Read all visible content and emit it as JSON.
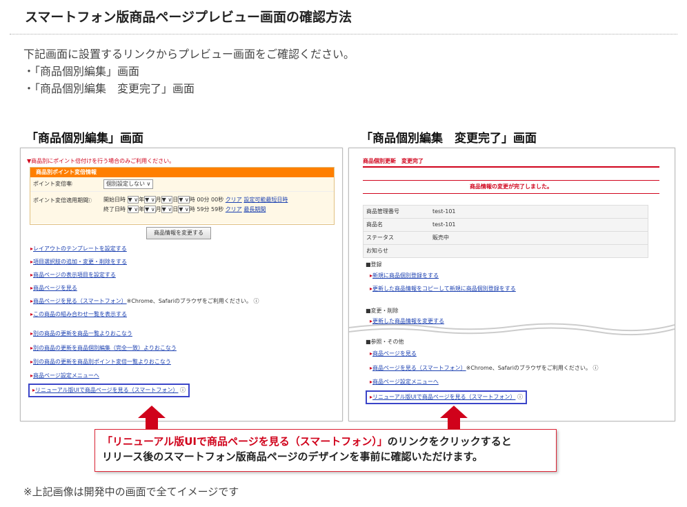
{
  "title": "スマートフォン版商品ページプレビュー画面の確認方法",
  "intro": {
    "line1": "下記画面に設置するリンクからプレビュー画面をご確認ください。",
    "line2": "・「商品個別編集」画面",
    "line3": "・「商品個別編集　変更完了」画面"
  },
  "left": {
    "heading": "「商品個別編集」画面",
    "notice": "▼商品別にポイント倍付けを行う場合のみご利用ください。",
    "table_header": "商品別ポイント変倍情報",
    "row1_label": "ポイント変倍率",
    "row1_value": "個別設定しない",
    "row2_label": "ポイント変倍適用期間",
    "start_label": "開始日時",
    "end_label": "終了日時",
    "start_tail": "時 00分 00秒",
    "end_tail": "時 59分 59秒",
    "clear": "クリア",
    "start_link": "設定可能最短日時",
    "end_link": "最長期間",
    "change_button": "商品情報を変更する",
    "links": [
      "レイアウトのテンプレートを設定する",
      "項目選択肢の追加・変更・削除をする",
      "商品ページの表示項目を設定する",
      "商品ページを見る",
      "商品ページを見る（スマートフォン）",
      "この商品の組み合わせ一覧を表示する",
      "別の商品の更新を商品一覧よりおこなう",
      "別の商品の更新を商品個別編集（完全一致）よりおこなう",
      "別の商品の更新を商品別ポイント変倍一覧よりおこなう",
      "商品ページ設定メニューへ"
    ],
    "sp_note": "※Chrome、Safariのブラウザをご利用ください。",
    "highlight_link": "リニューアル版UIで商品ページを見る（スマートフォン）"
  },
  "right": {
    "heading": "「商品個別編集　変更完了」画面",
    "top_label": "商品個別更新　変更完了",
    "done_msg": "商品情報の変更が完了しました。",
    "info_rows": [
      {
        "label": "商品管理番号",
        "value": "test-101"
      },
      {
        "label": "商品名",
        "value": "test-101"
      },
      {
        "label": "ステータス",
        "value": "販売中"
      },
      {
        "label": "お知らせ",
        "value": ""
      }
    ],
    "sec_register": "■登録",
    "reg_links": [
      "新規に商品個別登録をする",
      "更新した商品情報をコピーして新規に商品個別登録をする"
    ],
    "sec_change": "■変更・削除",
    "change_link": "更新した商品情報を変更する",
    "sec_ref": "■参照・その他",
    "ref_links": [
      "商品ページを見る",
      "商品ページを見る（スマートフォン）",
      "商品ページ設定メニューへ"
    ],
    "sp_note": "※Chrome、Safariのブラウザをご利用ください。",
    "highlight_link": "リニューアル版UIで商品ページを見る（スマートフォン）"
  },
  "callout": {
    "quote": "「リニューアル版UIで商品ページを見る（スマートフォン）」",
    "rest1": "のリンクをクリックすると",
    "line2": "リリース後のスマートフォン版商品ページのデザインを事前に確認いただけます。"
  },
  "footnote": "※上記画像は開発中の画面で全てイメージです",
  "colors": {
    "accent_orange": "#ff7f00",
    "highlight_blue": "#3a44c8",
    "arrow_red": "#d0021b"
  }
}
